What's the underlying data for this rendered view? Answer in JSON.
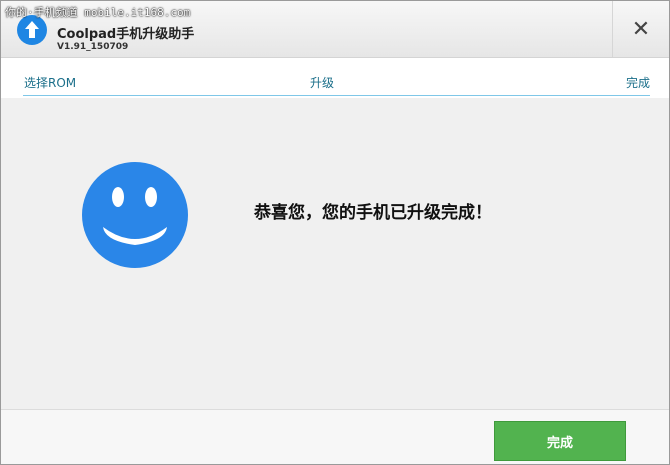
{
  "watermark": "你的·手机频道 mobile.it168.com",
  "app": {
    "title": "Coolpad手机升级助手",
    "version": "V1.91_150709",
    "icon": "upload-arrow-icon",
    "accent_color": "#1f86e3"
  },
  "close_label": "✕",
  "steps": [
    {
      "label": "选择ROM"
    },
    {
      "label": "升级"
    },
    {
      "label": "完成"
    }
  ],
  "message": "恭喜您，您的手机已升级完成！",
  "smiley": {
    "icon": "smiley-face-icon",
    "color": "#2a86e8"
  },
  "footer": {
    "finish_label": "完成",
    "finish_color": "#52b34f"
  }
}
